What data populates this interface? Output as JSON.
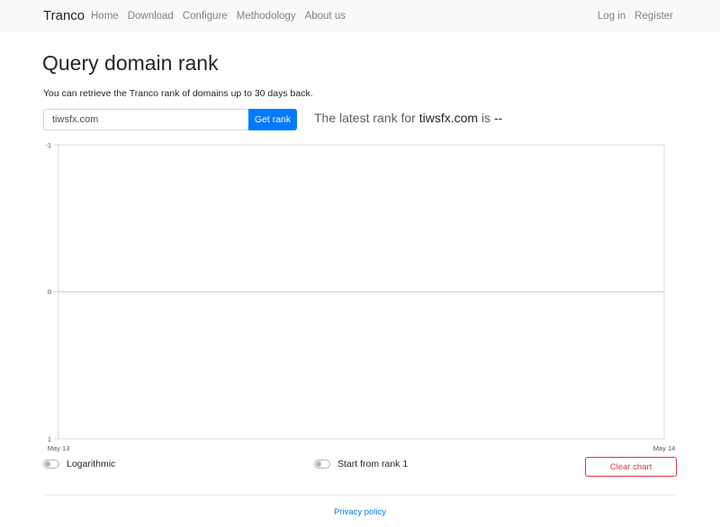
{
  "navbar": {
    "brand": "Tranco",
    "items": [
      {
        "label": "Home"
      },
      {
        "label": "Download"
      },
      {
        "label": "Configure"
      },
      {
        "label": "Methodology"
      },
      {
        "label": "About us"
      }
    ],
    "right_items": [
      {
        "label": "Log in"
      },
      {
        "label": "Register"
      }
    ]
  },
  "main": {
    "title": "Query domain rank",
    "lead": "You can retrieve the Tranco rank of domains up to 30 days back.",
    "search": {
      "value": "tiwsfx.com",
      "button_label": "Get rank"
    },
    "latest": {
      "prefix": "The latest rank for ",
      "domain": "tiwsfx.com",
      "middle": " is ",
      "rank": "--"
    }
  },
  "chart_data": {
    "type": "line",
    "title": "",
    "xlabel": "",
    "ylabel": "",
    "x_ticks": [
      "May 13",
      "May 14"
    ],
    "y_ticks": [
      "-1",
      "0",
      "1"
    ],
    "ylim": [
      -1,
      1
    ],
    "series": [],
    "grid": true
  },
  "controls": {
    "logarithmic_label": "Logarithmic",
    "start_from_rank1_label": "Start from rank 1",
    "clear_chart_label": "Clear chart"
  },
  "footer": {
    "privacy_label": "Privacy policy"
  },
  "colors": {
    "primary": "#007bff",
    "danger": "#dc3545",
    "navbar_bg": "#f8f9fa"
  }
}
